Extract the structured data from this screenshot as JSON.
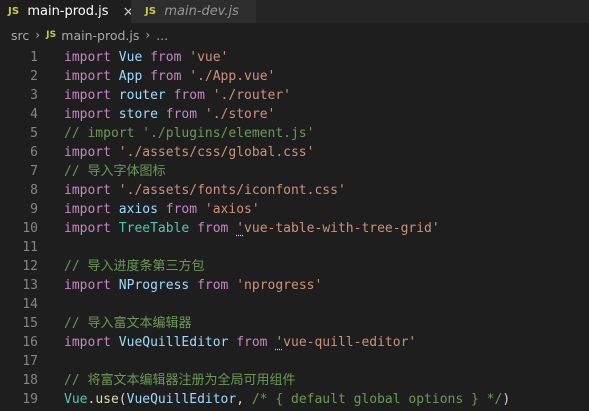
{
  "tabs": [
    {
      "icon": "JS",
      "label": "main-prod.js",
      "close": "×"
    },
    {
      "icon": "JS",
      "label": "main-dev.js"
    }
  ],
  "breadcrumb": {
    "folder": "src",
    "sep": "›",
    "icon": "JS",
    "file": "main-prod.js",
    "tail": "..."
  },
  "lines": [
    {
      "n": "1",
      "tokens": [
        [
          "kw",
          "import"
        ],
        [
          "pun",
          " "
        ],
        [
          "id",
          "Vue"
        ],
        [
          "pun",
          " "
        ],
        [
          "kw",
          "from"
        ],
        [
          "pun",
          " "
        ],
        [
          "str",
          "'vue'"
        ]
      ]
    },
    {
      "n": "2",
      "tokens": [
        [
          "kw",
          "import"
        ],
        [
          "pun",
          " "
        ],
        [
          "id",
          "App"
        ],
        [
          "pun",
          " "
        ],
        [
          "kw",
          "from"
        ],
        [
          "pun",
          " "
        ],
        [
          "str",
          "'./App.vue'"
        ]
      ]
    },
    {
      "n": "3",
      "tokens": [
        [
          "kw",
          "import"
        ],
        [
          "pun",
          " "
        ],
        [
          "id",
          "router"
        ],
        [
          "pun",
          " "
        ],
        [
          "kw",
          "from"
        ],
        [
          "pun",
          " "
        ],
        [
          "str",
          "'./router'"
        ]
      ]
    },
    {
      "n": "4",
      "tokens": [
        [
          "kw",
          "import"
        ],
        [
          "pun",
          " "
        ],
        [
          "id",
          "store"
        ],
        [
          "pun",
          " "
        ],
        [
          "kw",
          "from"
        ],
        [
          "pun",
          " "
        ],
        [
          "str",
          "'./store'"
        ]
      ]
    },
    {
      "n": "5",
      "tokens": [
        [
          "cmt",
          "// import './plugins/element.js'"
        ]
      ]
    },
    {
      "n": "6",
      "tokens": [
        [
          "kw",
          "import"
        ],
        [
          "pun",
          " "
        ],
        [
          "str",
          "'./assets/css/global.css'"
        ]
      ]
    },
    {
      "n": "7",
      "tokens": [
        [
          "cmt",
          "// 导入字体图标"
        ]
      ]
    },
    {
      "n": "8",
      "tokens": [
        [
          "kw",
          "import"
        ],
        [
          "pun",
          " "
        ],
        [
          "str",
          "'./assets/fonts/iconfont.css'"
        ]
      ]
    },
    {
      "n": "9",
      "tokens": [
        [
          "kw",
          "import"
        ],
        [
          "pun",
          " "
        ],
        [
          "id",
          "axios"
        ],
        [
          "pun",
          " "
        ],
        [
          "kw",
          "from"
        ],
        [
          "pun",
          " "
        ],
        [
          "str",
          "'axios'"
        ]
      ]
    },
    {
      "n": "10",
      "tokens": [
        [
          "kw",
          "import"
        ],
        [
          "pun",
          " "
        ],
        [
          "cls",
          "TreeTable"
        ],
        [
          "pun",
          " "
        ],
        [
          "kw",
          "from"
        ],
        [
          "pun",
          " "
        ],
        [
          "str squig",
          "'"
        ],
        [
          "str",
          "vue-table-with-tree-grid'"
        ]
      ]
    },
    {
      "n": "11",
      "tokens": []
    },
    {
      "n": "12",
      "tokens": [
        [
          "cmt",
          "// 导入进度条第三方包"
        ]
      ]
    },
    {
      "n": "13",
      "tokens": [
        [
          "kw",
          "import"
        ],
        [
          "pun",
          " "
        ],
        [
          "id",
          "NProgress"
        ],
        [
          "pun",
          " "
        ],
        [
          "kw",
          "from"
        ],
        [
          "pun",
          " "
        ],
        [
          "str",
          "'nprogress'"
        ]
      ]
    },
    {
      "n": "14",
      "tokens": []
    },
    {
      "n": "15",
      "tokens": [
        [
          "cmt",
          "// 导入富文本编辑器"
        ]
      ]
    },
    {
      "n": "16",
      "tokens": [
        [
          "kw",
          "import"
        ],
        [
          "pun",
          " "
        ],
        [
          "id",
          "VueQuillEditor"
        ],
        [
          "pun",
          " "
        ],
        [
          "kw",
          "from"
        ],
        [
          "pun",
          " "
        ],
        [
          "str squig",
          "'"
        ],
        [
          "str",
          "vue-quill-editor'"
        ]
      ]
    },
    {
      "n": "17",
      "tokens": []
    },
    {
      "n": "18",
      "tokens": [
        [
          "cmt",
          "// 将富文本编辑器注册为全局可用组件"
        ]
      ]
    },
    {
      "n": "19",
      "tokens": [
        [
          "cls",
          "Vue"
        ],
        [
          "pun",
          "."
        ],
        [
          "fn",
          "use"
        ],
        [
          "pun",
          "("
        ],
        [
          "id",
          "VueQuillEditor"
        ],
        [
          "pun",
          ", "
        ],
        [
          "cmt",
          "/* { default global options } */"
        ],
        [
          "pun",
          ")"
        ]
      ]
    }
  ],
  "colors": {
    "background": "#1e1e1e",
    "keyword": "#c586c0",
    "identifier": "#9cdcfe",
    "class": "#4ec9b0",
    "string": "#ce9178",
    "comment": "#6a9955",
    "function": "#dcdcaa",
    "js_icon": "#cbcb41"
  }
}
